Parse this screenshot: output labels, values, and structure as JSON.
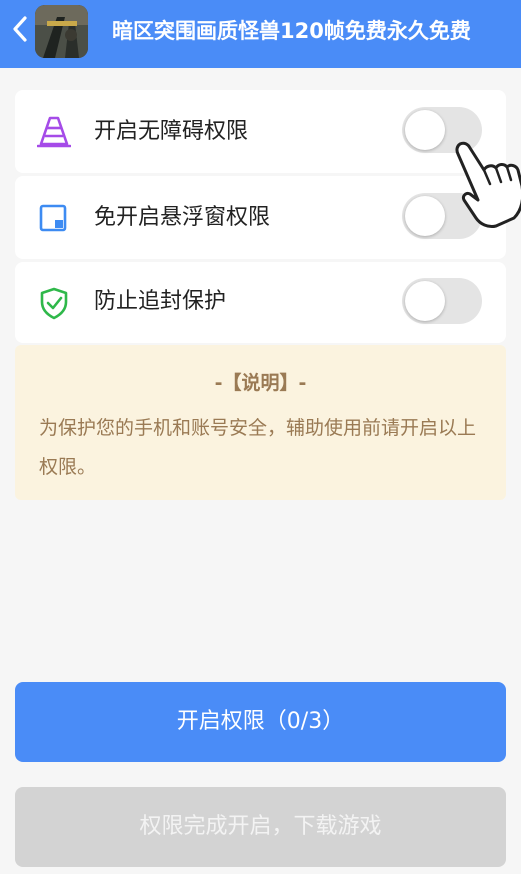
{
  "header": {
    "title": "暗区突围画质怪兽120帧免费永久免费",
    "back_icon": "chevron-left-icon",
    "app_icon": "game-app-icon",
    "background_color": "#4a8cf7"
  },
  "permissions": [
    {
      "label": "开启无障碍权限",
      "icon": "accessibility-cone-icon",
      "icon_color": "#a54be8",
      "enabled": false
    },
    {
      "label": "免开启悬浮窗权限",
      "icon": "floating-window-icon",
      "icon_color": "#3d8bf2",
      "enabled": false
    },
    {
      "label": "防止追封保护",
      "icon": "shield-check-icon",
      "icon_color": "#2fb84a",
      "enabled": false
    }
  ],
  "note": {
    "title": "-【说明】-",
    "text": "为保护您的手机和账号安全，辅助使用前请开启以上权限。"
  },
  "buttons": {
    "primary_label": "开启权限（0/3）",
    "secondary_label": "权限完成开启，下载游戏"
  },
  "hint_icon": "pointing-hand-icon"
}
